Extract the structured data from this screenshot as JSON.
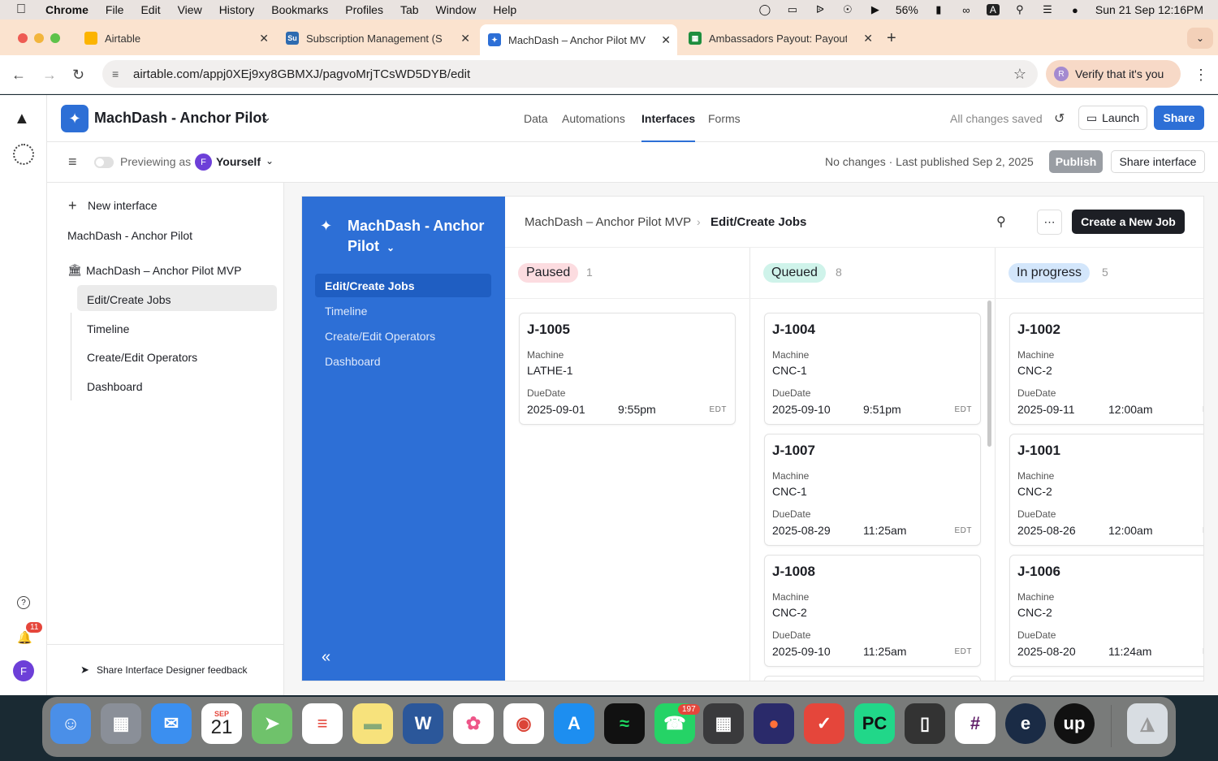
{
  "menubar": {
    "app": "Chrome",
    "items": [
      "File",
      "Edit",
      "View",
      "History",
      "Bookmarks",
      "Profiles",
      "Tab",
      "Window",
      "Help"
    ],
    "battery": "56%",
    "input_source": "A",
    "datetime": "Sun 21 Sep  12:16PM"
  },
  "tabs": [
    {
      "title": "Airtable",
      "fav_color": "#fcb400",
      "fav_text": ""
    },
    {
      "title": "Subscription Management (S",
      "fav_color": "#2e6bb0",
      "fav_text": "Su"
    },
    {
      "title": "MachDash – Anchor Pilot MV",
      "fav_color": "#2d6fd6",
      "fav_text": ""
    },
    {
      "title": "Ambassadors Payout: Payout",
      "fav_color": "#1e8e3e",
      "fav_text": ""
    }
  ],
  "address": {
    "url": "airtable.com/appj0XEj9xy8GBMXJ/pagvoMrjTCsWD5DYB/edit",
    "verify_label": "Verify that it's you",
    "profile_initial": "R"
  },
  "topnav": {
    "base_name": "MachDash - Anchor Pilot",
    "tabs": [
      "Data",
      "Automations",
      "Interfaces",
      "Forms"
    ],
    "saved": "All changes saved",
    "launch": "Launch",
    "share": "Share"
  },
  "subbar": {
    "previewing": "Previewing as",
    "user_initial": "F",
    "user": "Yourself",
    "status": "No changes · Last published Sep 2, 2025",
    "publish": "Publish",
    "share_interface": "Share interface"
  },
  "sidepanel": {
    "new_interface": "New interface",
    "section": "MachDash - Anchor Pilot",
    "group": "MachDash – Anchor Pilot MVP",
    "pages": [
      "Edit/Create Jobs",
      "Timeline",
      "Create/Edit Operators",
      "Dashboard"
    ],
    "feedback": "Share Interface Designer feedback"
  },
  "rail": {
    "notif_count": "11",
    "user_initial": "F"
  },
  "interface": {
    "title": "MachDash - Anchor Pilot",
    "nav": [
      "Edit/Create Jobs",
      "Timeline",
      "Create/Edit Operators",
      "Dashboard"
    ],
    "breadcrumb_parent": "MachDash – Anchor Pilot MVP",
    "breadcrumb_current": "Edit/Create Jobs",
    "create_button": "Create a New Job",
    "field_machine": "Machine",
    "field_due": "DueDate",
    "columns": [
      {
        "status": "Paused",
        "count": "1",
        "pill_bg": "#fcdce0",
        "cards": [
          {
            "id": "J-1005",
            "machine": "LATHE-1",
            "date": "2025-09-01",
            "time": "9:55pm",
            "tz": "EDT"
          }
        ]
      },
      {
        "status": "Queued",
        "count": "8",
        "pill_bg": "#cff3ea",
        "cards": [
          {
            "id": "J-1004",
            "machine": "CNC-1",
            "date": "2025-09-10",
            "time": "9:51pm",
            "tz": "EDT"
          },
          {
            "id": "J-1007",
            "machine": "CNC-1",
            "date": "2025-08-29",
            "time": "11:25am",
            "tz": "EDT"
          },
          {
            "id": "J-1008",
            "machine": "CNC-2",
            "date": "2025-09-10",
            "time": "11:25am",
            "tz": "EDT"
          }
        ]
      },
      {
        "status": "In progress",
        "count": "5",
        "pill_bg": "#d3e6fb",
        "cards": [
          {
            "id": "J-1002",
            "machine": "CNC-2",
            "date": "2025-09-11",
            "time": "12:00am",
            "tz": "E"
          },
          {
            "id": "J-1001",
            "machine": "CNC-2",
            "date": "2025-08-26",
            "time": "12:00am",
            "tz": "E"
          },
          {
            "id": "J-1006",
            "machine": "CNC-2",
            "date": "2025-08-20",
            "time": "11:24am",
            "tz": "E"
          }
        ]
      }
    ]
  },
  "dock": {
    "calendar_month": "SEP",
    "calendar_day": "21",
    "whatsapp_badge": "197"
  }
}
